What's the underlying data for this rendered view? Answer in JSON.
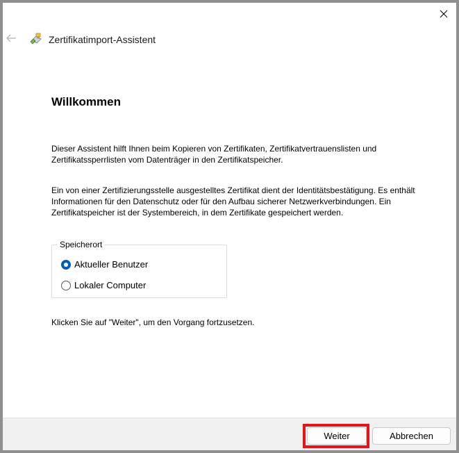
{
  "window": {
    "title": "Zertifikatimport-Assistent",
    "icons": {
      "back": "back-arrow-icon",
      "app": "certificate-icon",
      "close": "close-icon"
    }
  },
  "content": {
    "heading": "Willkommen",
    "paragraph1": "Dieser Assistent hilft Ihnen beim Kopieren von Zertifikaten, Zertifikatvertrauenslisten und Zertifikatssperrlisten vom Datenträger in den Zertifikatspeicher.",
    "paragraph2": "Ein von einer Zertifizierungsstelle ausgestelltes Zertifikat dient der Identitätsbestätigung. Es enthält Informationen für den Datenschutz oder für den Aufbau sicherer Netzwerkverbindungen. Ein Zertifikatspeicher ist der Systembereich, in dem Zertifikate gespeichert werden.",
    "store_location": {
      "legend": "Speicherort",
      "options": [
        {
          "label": "Aktueller Benutzer",
          "selected": true
        },
        {
          "label": "Lokaler Computer",
          "selected": false
        }
      ]
    },
    "paragraph3": "Klicken Sie auf \"Weiter\", um den Vorgang fortzusetzen."
  },
  "footer": {
    "next_label": "Weiter",
    "cancel_label": "Abbrechen"
  },
  "colors": {
    "accent": "#005fb8",
    "highlight": "#e3141c"
  }
}
